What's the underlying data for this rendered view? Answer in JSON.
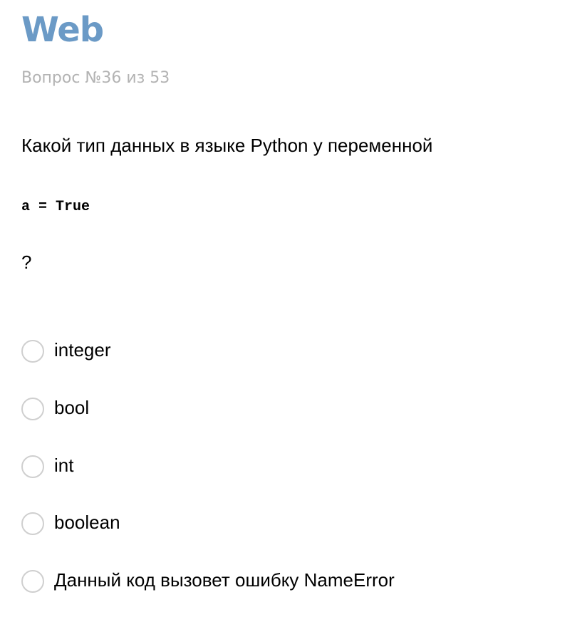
{
  "header": {
    "title": "Web",
    "counter": "Вопрос №36 из 53"
  },
  "question": {
    "text": "Какой тип данных в языке Python у переменной",
    "code": "a = True",
    "suffix": "?"
  },
  "options": [
    {
      "label": "integer",
      "checked": false
    },
    {
      "label": "bool",
      "checked": false
    },
    {
      "label": "int",
      "checked": false
    },
    {
      "label": "boolean",
      "checked": false
    },
    {
      "label": "Данный код вызовет ошибку NameError",
      "checked": false
    }
  ],
  "colors": {
    "title": "#6b9ac6",
    "counter": "#b3b3b3",
    "radio_border": "#cfcfcf"
  }
}
